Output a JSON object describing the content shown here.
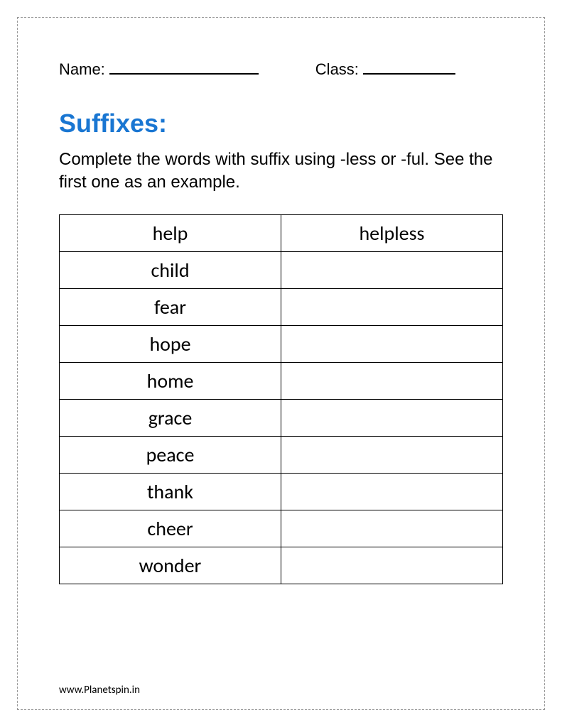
{
  "header": {
    "name_label": "Name:",
    "class_label": "Class:"
  },
  "title": "Suffixes:",
  "instructions": "Complete the words with suffix using -less or -ful. See the first one as an example.",
  "rows": [
    {
      "word": "help",
      "answer": "helpless"
    },
    {
      "word": "child",
      "answer": ""
    },
    {
      "word": "fear",
      "answer": ""
    },
    {
      "word": "hope",
      "answer": ""
    },
    {
      "word": "home",
      "answer": ""
    },
    {
      "word": "grace",
      "answer": ""
    },
    {
      "word": "peace",
      "answer": ""
    },
    {
      "word": "thank",
      "answer": ""
    },
    {
      "word": "cheer",
      "answer": ""
    },
    {
      "word": "wonder",
      "answer": ""
    }
  ],
  "footer": "www.Planetspin.in"
}
